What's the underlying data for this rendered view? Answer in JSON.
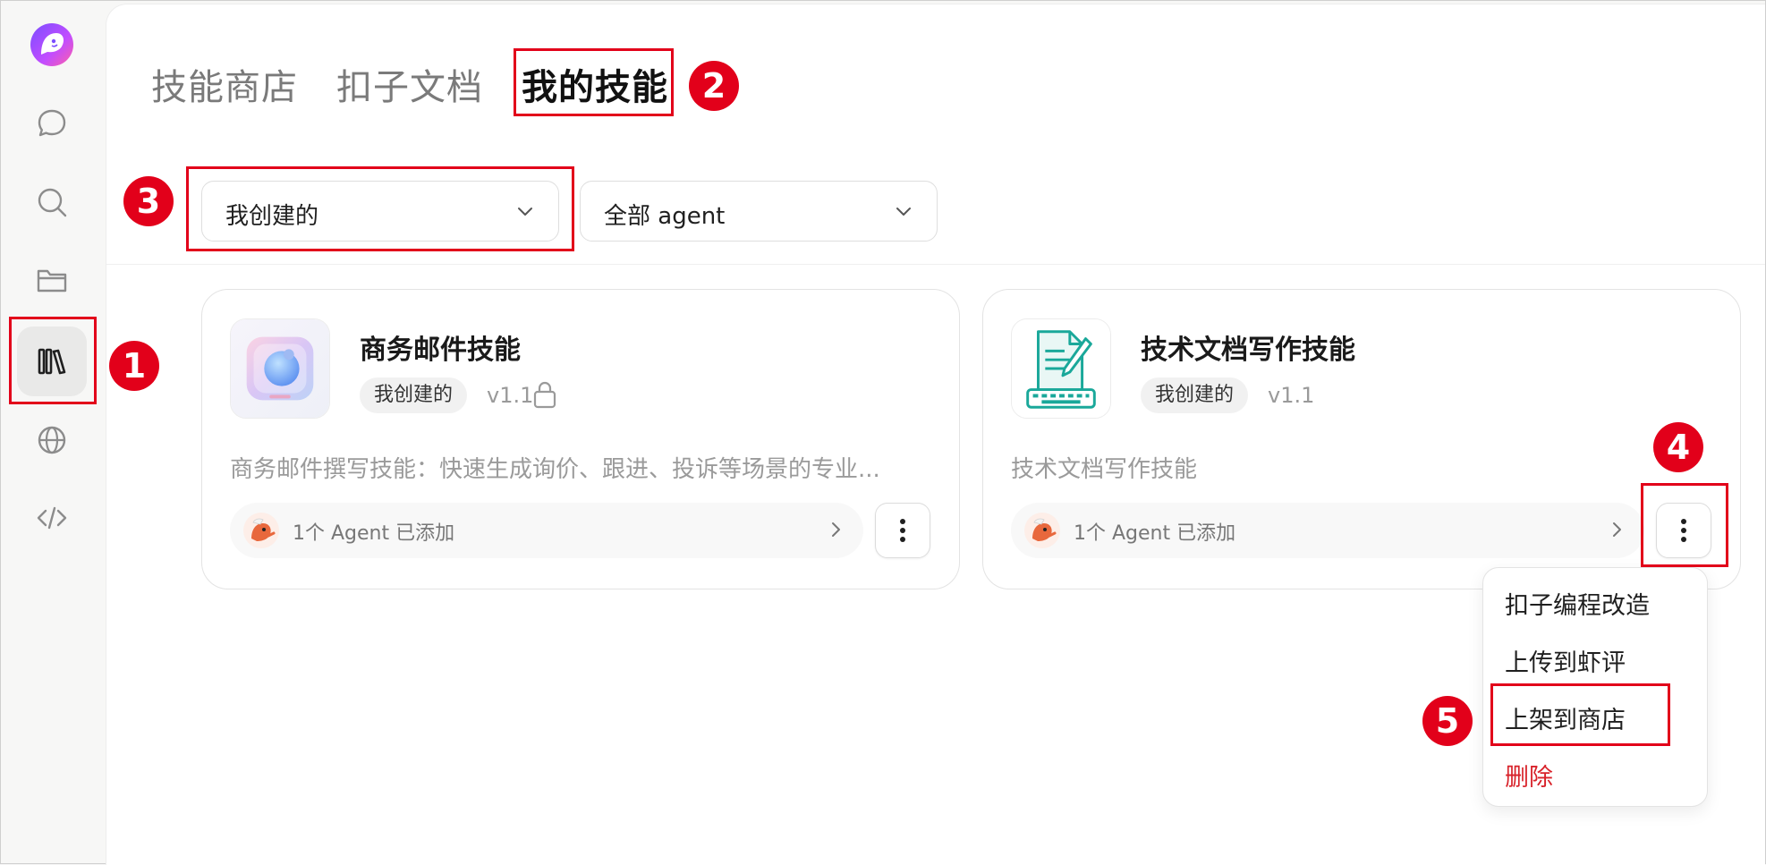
{
  "nav": {
    "items": [
      {
        "icon": "chat-icon"
      },
      {
        "icon": "search-icon"
      },
      {
        "icon": "folder-icon"
      },
      {
        "icon": "skills-library-icon",
        "active": true
      },
      {
        "icon": "globe-icon"
      },
      {
        "icon": "code-icon"
      }
    ]
  },
  "tabs": [
    {
      "label": "技能商店"
    },
    {
      "label": "扣子文档"
    },
    {
      "label": "我的技能",
      "active": true
    }
  ],
  "filters": {
    "owner": "我创建的",
    "agent": "全部 agent"
  },
  "cards": [
    {
      "title": "商务邮件技能",
      "badge": "我创建的",
      "version": "v1.1",
      "locked": true,
      "description": "商务邮件撰写技能：快速生成询价、跟进、投诉等场景的专业...",
      "agents": "1个 Agent 已添加"
    },
    {
      "title": "技术文档写作技能",
      "badge": "我创建的",
      "version": "v1.1",
      "locked": false,
      "description": "技术文档写作技能",
      "agents": "1个 Agent 已添加"
    }
  ],
  "menu": {
    "items": [
      {
        "label": "扣子编程改造"
      },
      {
        "label": "上传到虾评"
      },
      {
        "label": "上架到商店"
      },
      {
        "label": "删除",
        "danger": true
      }
    ]
  },
  "annotations": {
    "steps": [
      "1",
      "2",
      "3",
      "4",
      "5"
    ],
    "color": "#e2001a"
  },
  "colors": {
    "danger": "#d8222a",
    "annotation": "#e2001a"
  }
}
